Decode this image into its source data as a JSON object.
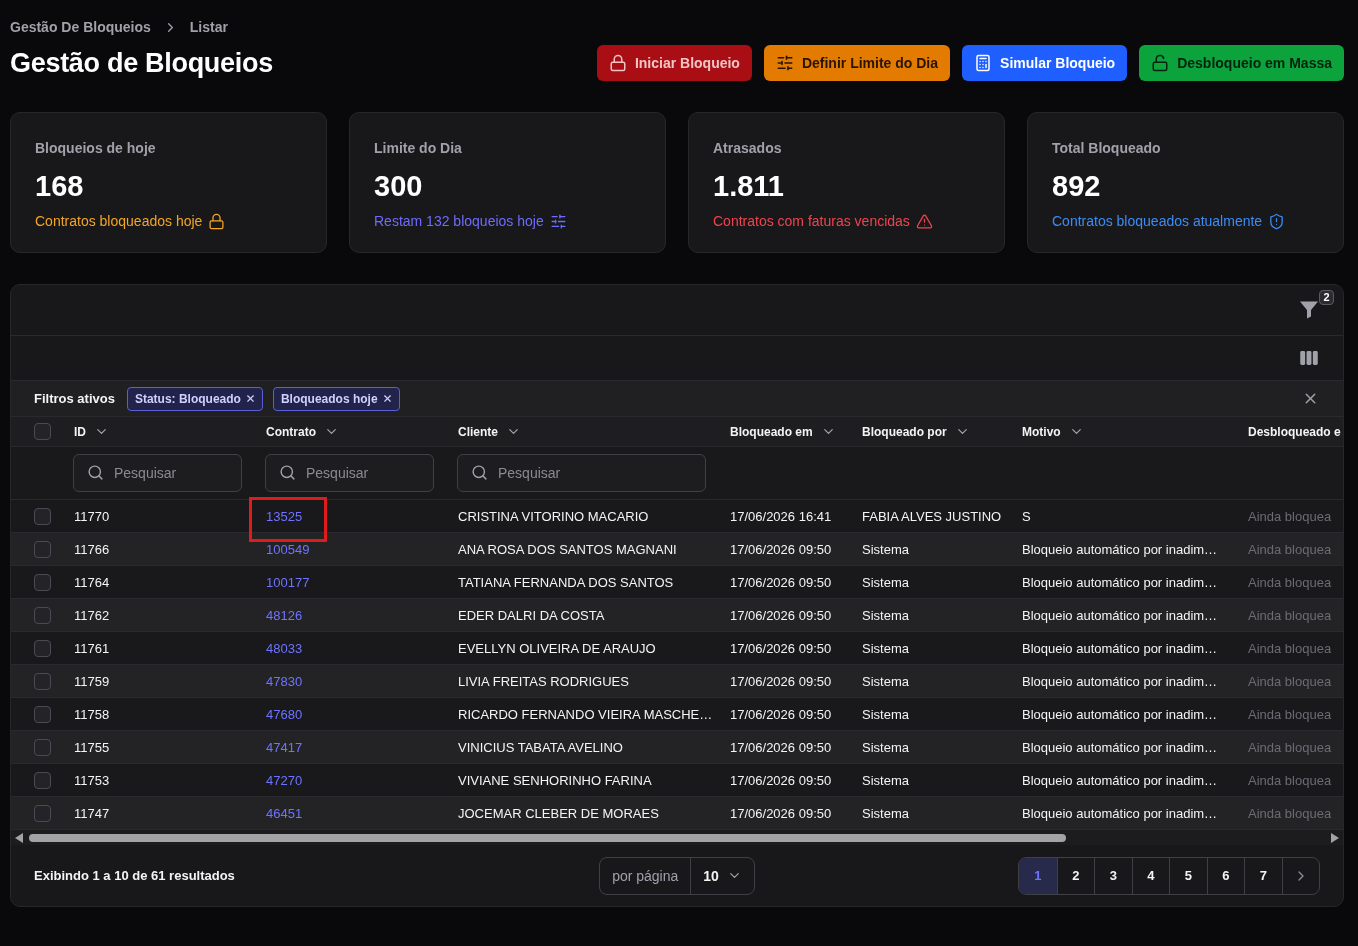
{
  "breadcrumb": [
    {
      "label": "Gestão De Bloqueios"
    },
    {
      "label": "Listar"
    }
  ],
  "title": "Gestão de Bloqueios",
  "actions": [
    {
      "label": "Iniciar Bloqueio",
      "kind": "danger"
    },
    {
      "label": "Definir Limite do Dia",
      "kind": "warning"
    },
    {
      "label": "Simular Bloqueio",
      "kind": "primary"
    },
    {
      "label": "Desbloqueio em Massa",
      "kind": "success"
    }
  ],
  "stats": [
    {
      "label": "Bloqueios de hoje",
      "value": "168",
      "note": "Contratos bloqueados hoje",
      "kind": "lock",
      "color": "#f5a524"
    },
    {
      "label": "Limite do Dia",
      "value": "300",
      "note": "Restam 132 bloqueios hoje",
      "kind": "sliders",
      "color": "#6e6bff"
    },
    {
      "label": "Atrasados",
      "value": "1.811",
      "note": "Contratos com faturas vencidas",
      "kind": "alert",
      "color": "#f0434e"
    },
    {
      "label": "Total Bloqueado",
      "value": "892",
      "note": "Contratos bloqueados atualmente",
      "kind": "shield",
      "color": "#3b8cf6"
    }
  ],
  "table": {
    "filter_count": "2",
    "active_filters": {
      "label": "Filtros ativos",
      "chips": [
        {
          "label": "Status: Bloqueado"
        },
        {
          "label": "Bloqueados hoje"
        }
      ]
    },
    "select_all": {
      "checked": false
    },
    "columns": [
      {
        "label": "ID",
        "kind": "text",
        "sortable": true,
        "filter": {
          "placeholder": "Pesquisar"
        }
      },
      {
        "label": "Contrato",
        "kind": "link",
        "sortable": true,
        "filter": {
          "placeholder": "Pesquisar"
        }
      },
      {
        "label": "Cliente",
        "kind": "text",
        "sortable": true,
        "filter": {
          "placeholder": "Pesquisar"
        }
      },
      {
        "label": "Bloqueado em",
        "kind": "text",
        "sortable": true
      },
      {
        "label": "Bloqueado por",
        "kind": "text",
        "sortable": true
      },
      {
        "label": "Motivo",
        "kind": "text",
        "sortable": true
      },
      {
        "label": "Desbloqueado e",
        "kind": "muted",
        "sortable": false
      }
    ],
    "rows": [
      {
        "checked": false,
        "highlighted": true,
        "cells": [
          "11770",
          "13525",
          "CRISTINA VITORINO MACARIO",
          "17/06/2026 16:41",
          "FABIA ALVES JUSTINO",
          "S",
          "Ainda bloquea"
        ]
      },
      {
        "checked": false,
        "highlighted": false,
        "cells": [
          "11766",
          "100549",
          "ANA ROSA DOS SANTOS MAGNANI",
          "17/06/2026 09:50",
          "Sistema",
          "Bloqueio automático por inadim…",
          "Ainda bloquea"
        ]
      },
      {
        "checked": false,
        "highlighted": false,
        "cells": [
          "11764",
          "100177",
          "TATIANA FERNANDA DOS SANTOS",
          "17/06/2026 09:50",
          "Sistema",
          "Bloqueio automático por inadim…",
          "Ainda bloquea"
        ]
      },
      {
        "checked": false,
        "highlighted": false,
        "cells": [
          "11762",
          "48126",
          "EDER DALRI DA COSTA",
          "17/06/2026 09:50",
          "Sistema",
          "Bloqueio automático por inadim…",
          "Ainda bloquea"
        ]
      },
      {
        "checked": false,
        "highlighted": false,
        "cells": [
          "11761",
          "48033",
          "EVELLYN OLIVEIRA DE ARAUJO",
          "17/06/2026 09:50",
          "Sistema",
          "Bloqueio automático por inadim…",
          "Ainda bloquea"
        ]
      },
      {
        "checked": false,
        "highlighted": false,
        "cells": [
          "11759",
          "47830",
          "LIVIA FREITAS RODRIGUES",
          "17/06/2026 09:50",
          "Sistema",
          "Bloqueio automático por inadim…",
          "Ainda bloquea"
        ]
      },
      {
        "checked": false,
        "highlighted": false,
        "cells": [
          "11758",
          "47680",
          "RICARDO FERNANDO VIEIRA MASCHE…",
          "17/06/2026 09:50",
          "Sistema",
          "Bloqueio automático por inadim…",
          "Ainda bloquea"
        ]
      },
      {
        "checked": false,
        "highlighted": false,
        "cells": [
          "11755",
          "47417",
          "VINICIUS TABATA AVELINO",
          "17/06/2026 09:50",
          "Sistema",
          "Bloqueio automático por inadim…",
          "Ainda bloquea"
        ]
      },
      {
        "checked": false,
        "highlighted": false,
        "cells": [
          "11753",
          "47270",
          "VIVIANE SENHORINHO FARINA",
          "17/06/2026 09:50",
          "Sistema",
          "Bloqueio automático por inadim…",
          "Ainda bloquea"
        ]
      },
      {
        "checked": false,
        "highlighted": false,
        "cells": [
          "11747",
          "46451",
          "JOCEMAR CLEBER DE MORAES",
          "17/06/2026 09:50",
          "Sistema",
          "Bloqueio automático por inadim…",
          "Ainda bloquea"
        ]
      }
    ]
  },
  "footer": {
    "summary": "Exibindo 1 a 10 de 61 resultados",
    "per_page": {
      "label": "por página",
      "value": "10"
    },
    "pages": [
      {
        "label": "1",
        "selected": true
      },
      {
        "label": "2",
        "selected": false
      },
      {
        "label": "3",
        "selected": false
      },
      {
        "label": "4",
        "selected": false
      },
      {
        "label": "5",
        "selected": false
      },
      {
        "label": "6",
        "selected": false
      },
      {
        "label": "7",
        "selected": false
      }
    ]
  }
}
